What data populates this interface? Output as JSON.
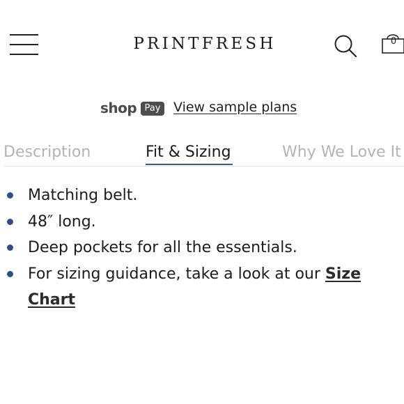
{
  "header": {
    "menu_icon": "hamburger-menu-icon",
    "brand": "PRINTFRESH",
    "search_icon": "search-icon",
    "cart_icon": "shopping-bag-icon",
    "cart_count": "0"
  },
  "shop_pay": {
    "shop_text": "shop",
    "pay_badge": "Pay",
    "sample_plans_link": "View sample plans"
  },
  "tabs": [
    {
      "label": "Description",
      "active": false
    },
    {
      "label": "Fit & Sizing",
      "active": true
    },
    {
      "label": "Why We Love It",
      "active": false
    }
  ],
  "details": {
    "items": [
      "Matching belt.",
      "48″ long.",
      "Deep pockets for all the essentials."
    ],
    "sizing_text": "For sizing guidance, take a look at our ",
    "size_chart_link": "Size Chart"
  },
  "colors": {
    "accent": "#2d4f84",
    "text": "#1c1c1c",
    "inactive_tab": "#b3b3b3"
  }
}
